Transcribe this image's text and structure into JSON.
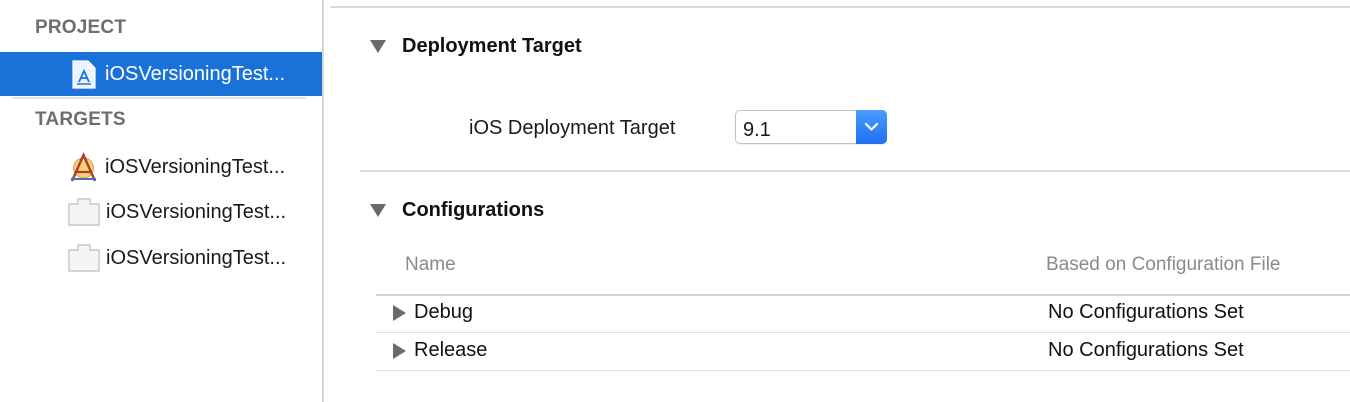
{
  "sidebar": {
    "project_header": "PROJECT",
    "targets_header": "TARGETS",
    "project_item": {
      "label": "iOSVersioningTest...",
      "icon": "xcode-project-icon"
    },
    "targets": [
      {
        "label": "iOSVersioningTest...",
        "icon": "app-target-icon"
      },
      {
        "label": "iOSVersioningTest...",
        "icon": "test-bundle-icon"
      },
      {
        "label": "iOSVersioningTest...",
        "icon": "test-bundle-icon"
      }
    ]
  },
  "deployment": {
    "title": "Deployment Target",
    "field_label": "iOS Deployment Target",
    "selected_version": "9.1"
  },
  "configurations": {
    "title": "Configurations",
    "columns": {
      "name": "Name",
      "based_on": "Based on Configuration File"
    },
    "rows": [
      {
        "name": "Debug",
        "based_on": "No Configurations Set"
      },
      {
        "name": "Release",
        "based_on": "No Configurations Set"
      }
    ]
  },
  "colors": {
    "selection": "#1a72d9",
    "accent": "#2f7ff5"
  }
}
